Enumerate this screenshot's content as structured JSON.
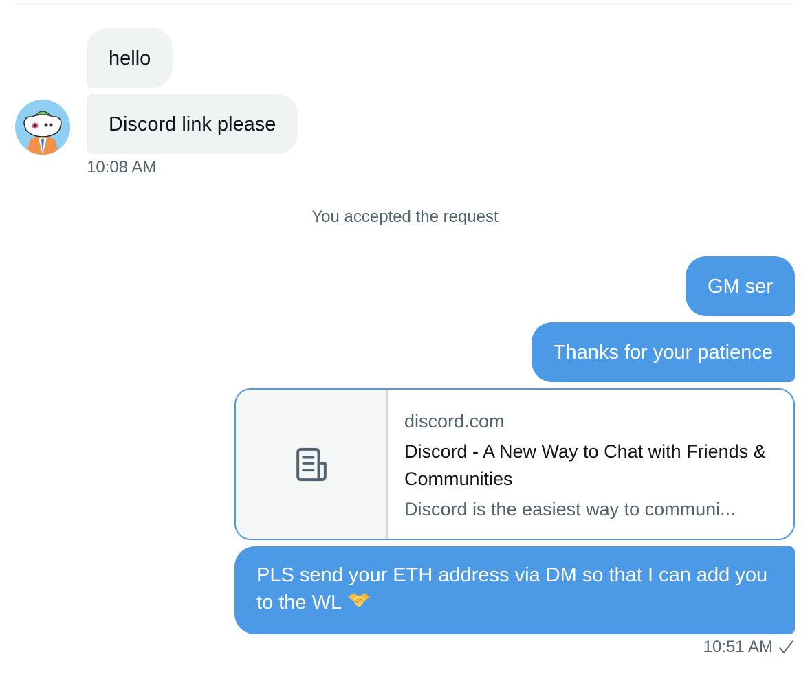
{
  "conversation": {
    "incoming": {
      "messages": [
        {
          "text": "hello"
        },
        {
          "text": "Discord link please"
        }
      ],
      "timestamp": "10:08 AM",
      "avatar_icon": "cloud-character-avatar"
    },
    "system_note": "You accepted the request",
    "outgoing": {
      "messages": [
        {
          "text": "GM ser"
        },
        {
          "text": "Thanks for your patience"
        }
      ],
      "link_card": {
        "domain": "discord.com",
        "title": "Discord - A New Way to Chat with Friends & Communities",
        "description": "Discord is the easiest way to communi...",
        "thumbnail_icon": "document-icon"
      },
      "final_message": {
        "text": "PLS send your ETH address via DM so that I can add you to the WL",
        "emoji_icon": "handshake-icon"
      },
      "timestamp": "10:51 AM",
      "status_icon": "checkmark-icon"
    }
  },
  "colors": {
    "outgoing_bubble": "#4c99e6",
    "incoming_bubble": "#eff3f4",
    "secondary_text": "#536471",
    "primary_text": "#0f1419"
  }
}
